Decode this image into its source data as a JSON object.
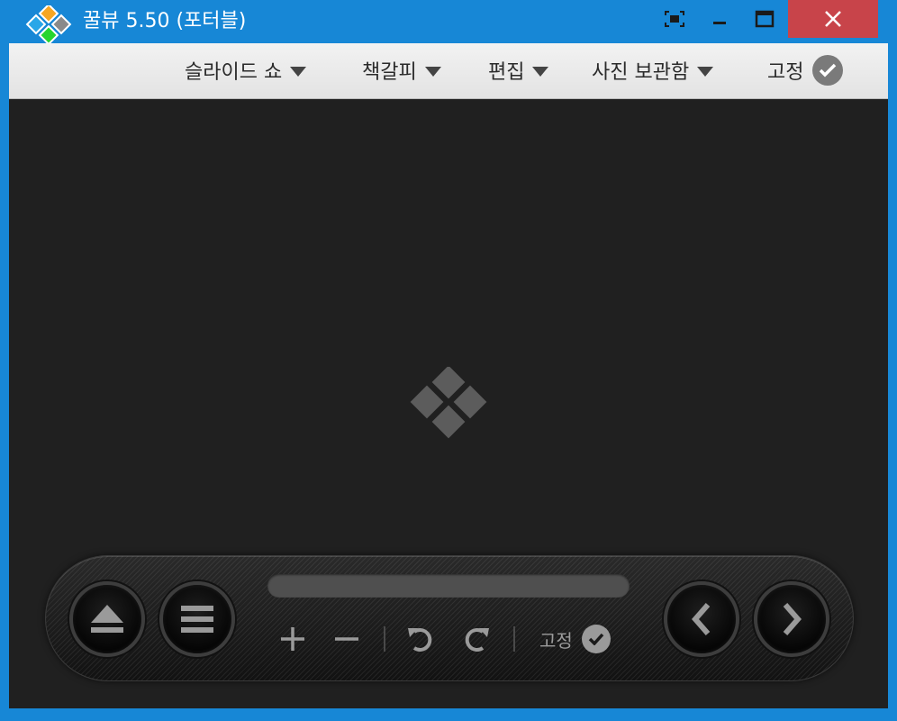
{
  "window": {
    "title": "꿀뷰 5.50 (포터블)",
    "accent_color": "#1787d6",
    "close_color": "#c8444a",
    "controls": [
      "focus-mode-icon",
      "minimize-icon",
      "maximize-icon",
      "close-icon"
    ]
  },
  "menubar": {
    "items": [
      {
        "label": "슬라이드 쇼",
        "icon": "chevron-down-icon"
      },
      {
        "label": "책갈피",
        "icon": "chevron-down-icon"
      },
      {
        "label": "편집",
        "icon": "chevron-down-icon"
      },
      {
        "label": "사진 보관함",
        "icon": "chevron-down-icon"
      }
    ],
    "pin_label": "고정",
    "pin_icon": "check-circle-icon"
  },
  "viewer": {
    "background": "#202020",
    "placeholder_icon": "honeyview-logo-icon"
  },
  "control_panel": {
    "progress_fraction": 0,
    "buttons": [
      "eject-icon",
      "menu-icon",
      "previous-icon",
      "next-icon"
    ],
    "tools": [
      "zoom-in-icon",
      "zoom-out-icon",
      "rotate-left-icon",
      "rotate-right-icon"
    ],
    "pin_label": "고정",
    "pin_icon": "check-circle-icon"
  }
}
